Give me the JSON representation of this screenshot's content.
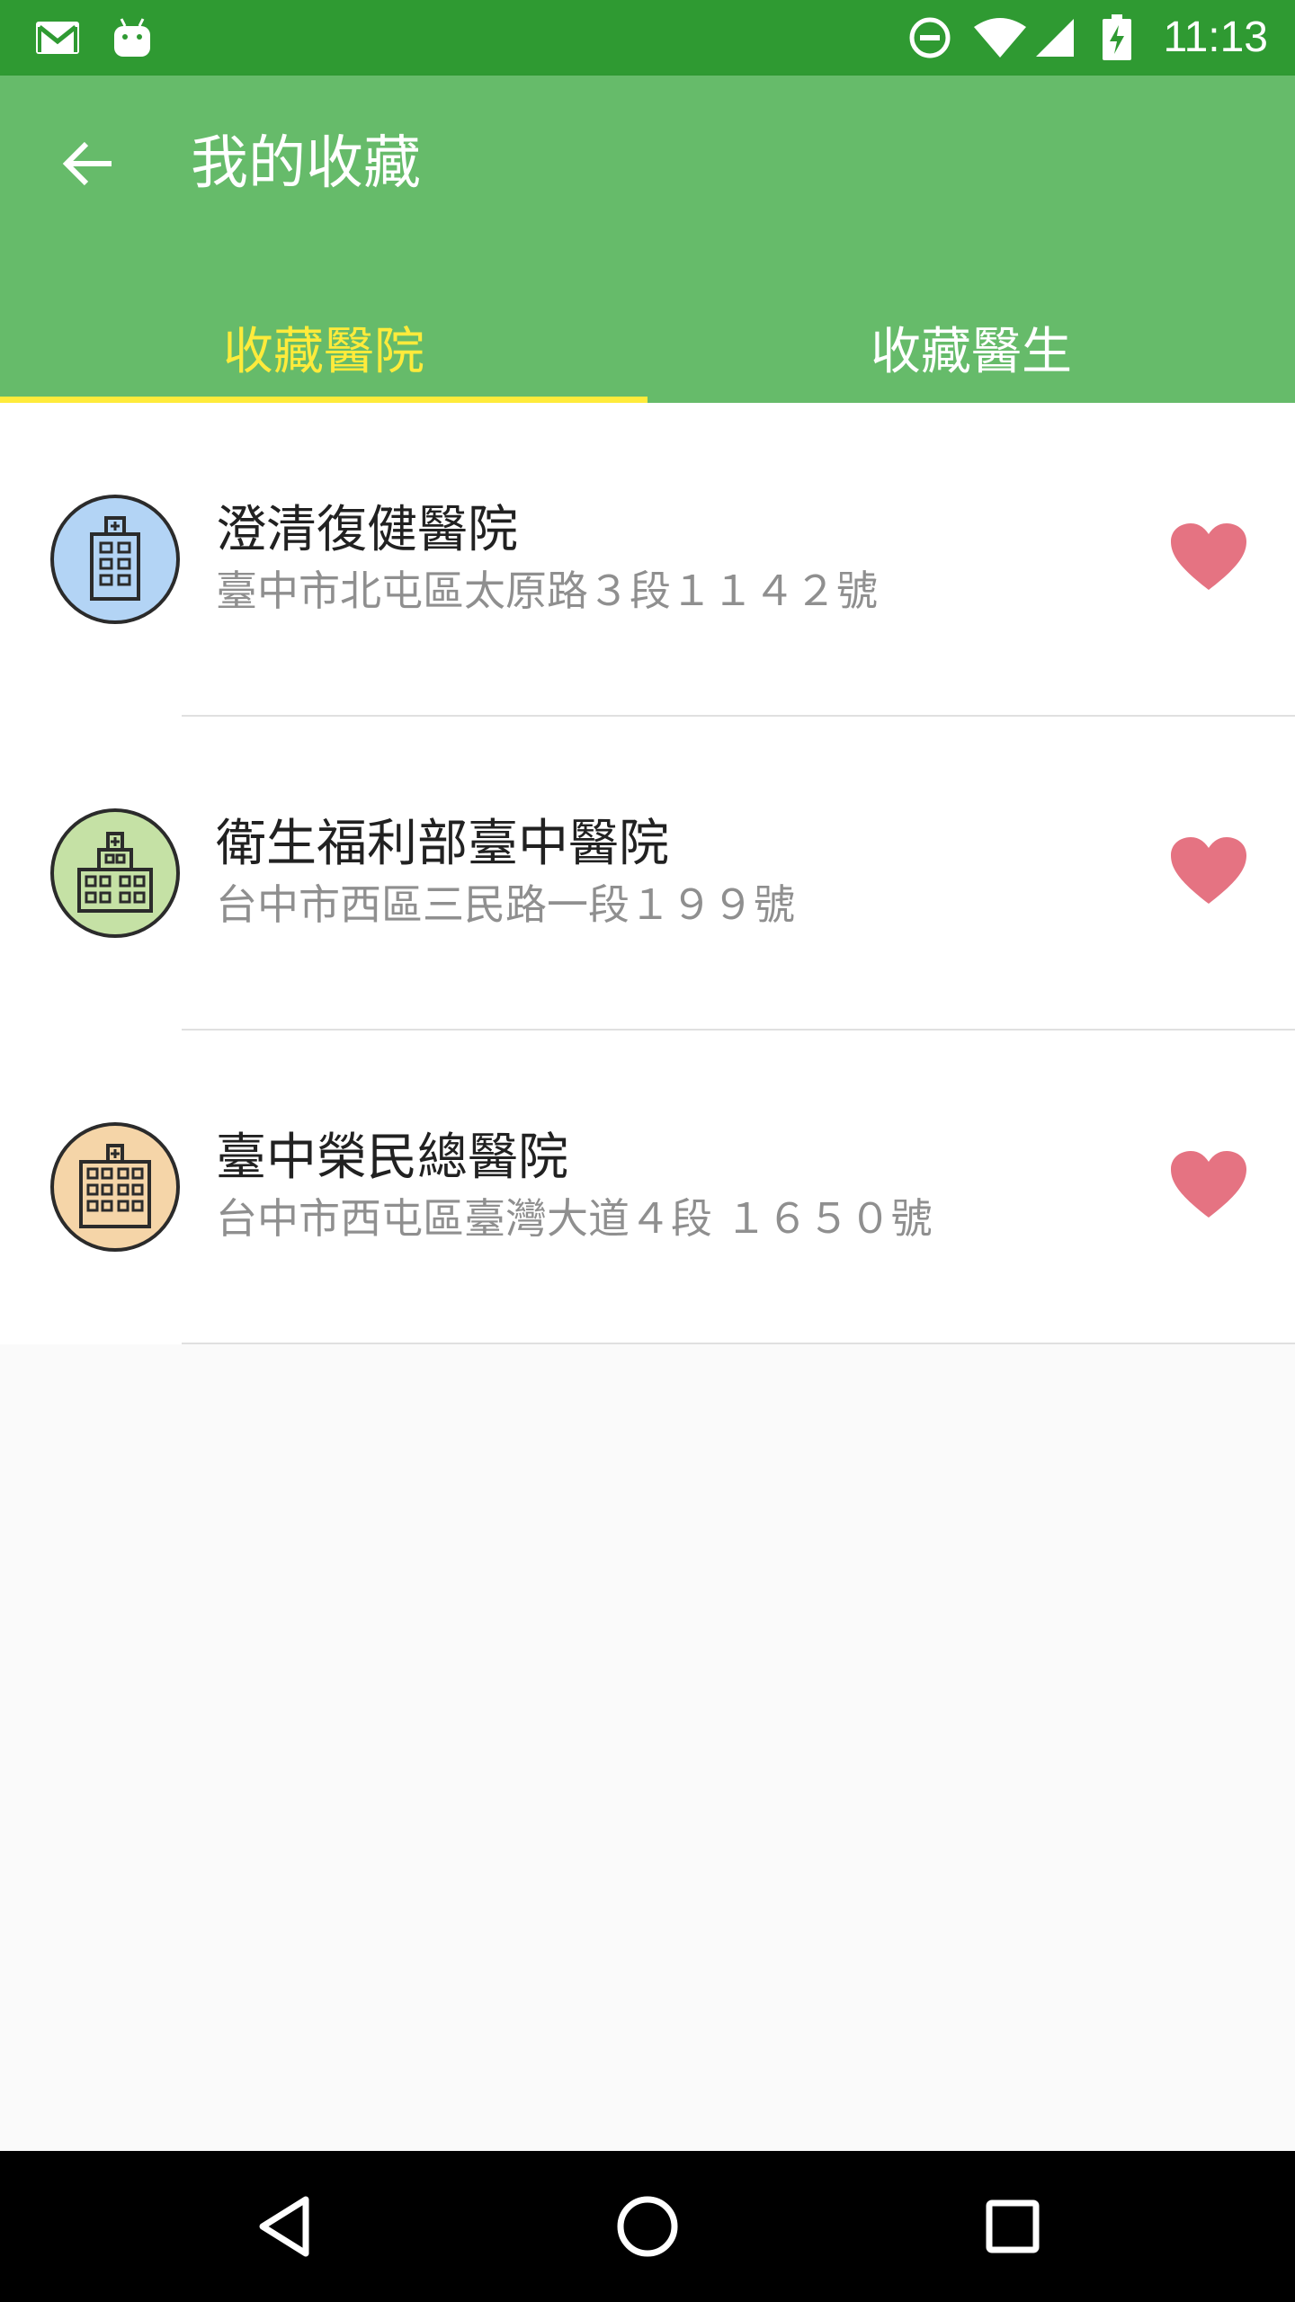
{
  "status_bar": {
    "time": "11:13",
    "icons": [
      "gmail-icon",
      "android-icon",
      "do-not-disturb-icon",
      "wifi-icon",
      "cell-signal-icon",
      "battery-charging-icon"
    ]
  },
  "app_bar": {
    "title": "我的收藏",
    "back_icon": "arrow-back-icon"
  },
  "tabs": [
    {
      "label": "收藏醫院",
      "active": true
    },
    {
      "label": "收藏醫生",
      "active": false
    }
  ],
  "hospitals": [
    {
      "name": "澄清復健醫院",
      "address": "臺中市北屯區太原路３段１１４２號",
      "avatar_bg": "#b3d4f5",
      "favorited": true
    },
    {
      "name": "衛生福利部臺中醫院",
      "address": "台中市西區三民路一段１９９號",
      "avatar_bg": "#c5e1a5",
      "favorited": true
    },
    {
      "name": "臺中榮民總醫院",
      "address": "台中市西屯區臺灣大道４段 １６５０號",
      "avatar_bg": "#f5d5a8",
      "favorited": true
    }
  ],
  "colors": {
    "status_bar": "#2f9a32",
    "app_bar": "#66bb6a",
    "tab_active": "#ffeb3b",
    "heart": "#e57373"
  },
  "nav_bar": {
    "icons": [
      "nav-back-icon",
      "nav-home-icon",
      "nav-recents-icon"
    ]
  }
}
